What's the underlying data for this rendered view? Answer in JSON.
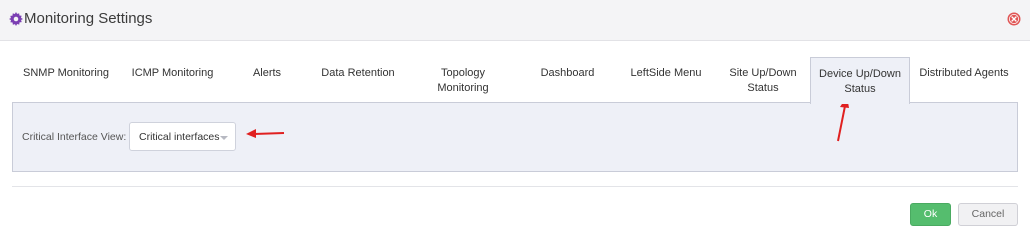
{
  "header": {
    "title": "Monitoring Settings",
    "title_icon": "gear-icon",
    "close_icon": "close-icon",
    "accent_color": "#7b3fb3",
    "close_color": "#e05656"
  },
  "tabs": [
    {
      "label": "SNMP Monitoring",
      "active": false
    },
    {
      "label": "ICMP Monitoring",
      "active": false
    },
    {
      "label": "Alerts",
      "active": false
    },
    {
      "label": "Data Retention",
      "active": false
    },
    {
      "label": "Topology\nMonitoring",
      "active": false
    },
    {
      "label": "Dashboard",
      "active": false
    },
    {
      "label": "LeftSide Menu",
      "active": false
    },
    {
      "label": "Site Up/Down\nStatus",
      "active": false
    },
    {
      "label": "Device Up/Down\nStatus",
      "active": true
    },
    {
      "label": "Distributed Agents",
      "active": false
    }
  ],
  "panel": {
    "field_label": "Critical Interface View:",
    "select_value": "Critical interfaces"
  },
  "footer": {
    "ok_label": "Ok",
    "cancel_label": "Cancel"
  },
  "annotation_color": "#e02020"
}
